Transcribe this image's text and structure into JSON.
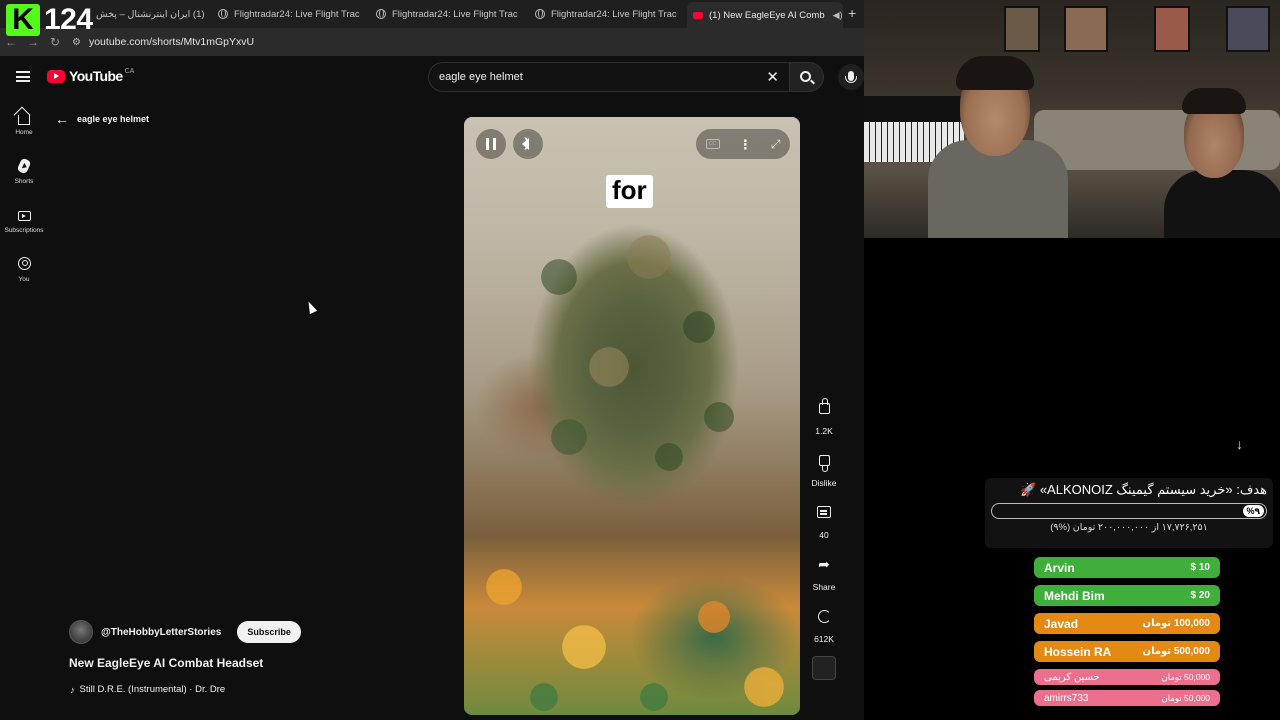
{
  "overlay": {
    "kick_count": "124"
  },
  "browser": {
    "tabs": [
      {
        "title": "(1) ایران اینترنشنال – پخش",
        "active": false
      },
      {
        "title": "Flightradar24: Live Flight Trac",
        "active": false
      },
      {
        "title": "Flightradar24: Live Flight Trac",
        "active": false
      },
      {
        "title": "Flightradar24: Live Flight Trac",
        "active": false
      },
      {
        "title": "(1) New EagleEye AI Comb",
        "active": true
      }
    ],
    "url": "youtube.com/shorts/Mtv1mGpYxvU"
  },
  "youtube": {
    "logo_text": "YouTube",
    "country": "CA",
    "search_value": "eagle eye helmet",
    "nav": [
      {
        "label": "Home",
        "icon": "home-icon"
      },
      {
        "label": "Shorts",
        "icon": "shorts-icon"
      },
      {
        "label": "Subscriptions",
        "icon": "subscriptions-icon"
      },
      {
        "label": "You",
        "icon": "you-icon"
      }
    ],
    "back_label": "eagle eye helmet",
    "player": {
      "caption": "for"
    },
    "actions": {
      "likes": "1.2K",
      "dislike": "Dislike",
      "comments": "40",
      "share": "Share",
      "remix": "612K"
    },
    "channel": "@TheHobbyLetterStories",
    "subscribe": "Subscribe",
    "video_title": "New EagleEye AI Combat Headset",
    "music": "Still D.R.E. (Instrumental) · Dr. Dre"
  },
  "stream": {
    "goal_title": "هدف: «خرید سیستم گیمینگ ALKONOIZ» 🚀",
    "goal_percent": "%۹",
    "goal_amount": "۱۷,۷۲۶,۲۵۱ از ۲۰۰,۰۰۰,۰۰۰ تومان (%۹)",
    "donations": [
      {
        "name": "Arvin",
        "amount": "$ 10",
        "color": "#3fae3a"
      },
      {
        "name": "Mehdi Bim",
        "amount": "$ 20",
        "color": "#3fae3a"
      },
      {
        "name": "Javad",
        "amount": "100,000 تومان",
        "color": "#e48a14"
      },
      {
        "name": "Hossein RA",
        "amount": "500,000 تومان",
        "color": "#e48a14"
      },
      {
        "name": "حسین کریمی",
        "amount": "50,000 تومان",
        "color": "#ec6f8e"
      },
      {
        "name": "amirrs733",
        "amount": "50,000 تومان",
        "color": "#ec6f8e"
      }
    ]
  }
}
